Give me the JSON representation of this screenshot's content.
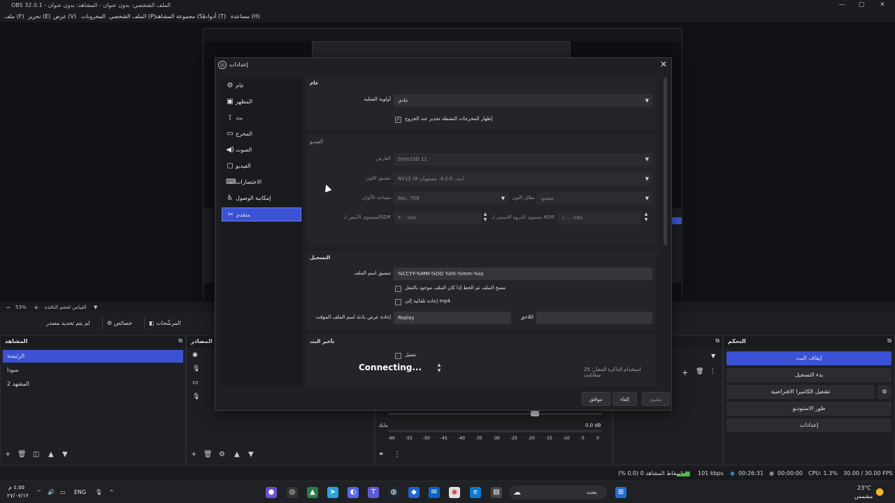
{
  "window": {
    "title": "OBS 32.0.1 - الملف الشخصي: بدون عنوان - المشاهد: بدون عنوان",
    "controls": [
      "—",
      "▢",
      "✕"
    ]
  },
  "menu": [
    "ملف (F)",
    "تحرير (E)",
    "عرض (V)",
    "المخزونات",
    "الملف الشخصي (P)",
    "مجموعة المشاهد (S)",
    "أدوات (T)",
    "مساعدة (H)"
  ],
  "preview_bar": {
    "zoom": "53%",
    "scale_label": "القياس لحجم النافذة"
  },
  "toolrow": {
    "no_source": "لم يتم تحديد مصدر",
    "properties": "خصائص",
    "filters": "المرشّحات"
  },
  "docks": {
    "scenes": {
      "title": "المشاهد",
      "items": [
        "الرئيسة",
        "سودا",
        "المشهد 2"
      ]
    },
    "sources": {
      "title": "المصادر"
    },
    "controls": {
      "title": "التحكم",
      "buttons": [
        "إيقاف البث",
        "بدء التسجيل",
        "تشغيل الكاميرا الافتراضية",
        "طور الاستوديو",
        "إعدادات"
      ]
    },
    "mixer": {
      "mic_label": "مايك",
      "db": "0.0 dB",
      "ticks": [
        "-60",
        "-55",
        "-50",
        "-45",
        "-40",
        "-35",
        "-30",
        "-25",
        "-20",
        "-15",
        "-10",
        "-5",
        "0"
      ]
    }
  },
  "status": {
    "dropped": "إسقاط المشاهد 0 (0.0 %)",
    "bitrate": "101 kbps",
    "stream_time": "00:26:31",
    "rec_time": "00:00:00",
    "cpu": "CPU: 1.3%",
    "fps": "30.00 / 30.00 FPS"
  },
  "taskbar": {
    "weather_temp": "23°C",
    "weather_desc": "مشمس",
    "search": "بحث",
    "lang": "ENG",
    "time": "٤:٥٥ م",
    "date": "٢٧/٠٧/١٢"
  },
  "dialog": {
    "title": "إعدادات",
    "nav": [
      {
        "label": "عام",
        "icon": "gear-icon",
        "glyph": "⚙"
      },
      {
        "label": "المظهر",
        "icon": "appearance-icon",
        "glyph": "▣"
      },
      {
        "label": "بث",
        "icon": "antenna-icon",
        "glyph": "📡"
      },
      {
        "label": "المخرج",
        "icon": "output-icon",
        "glyph": "▭"
      },
      {
        "label": "الصوت",
        "icon": "speaker-icon",
        "glyph": "🔊"
      },
      {
        "label": "الفيديو",
        "icon": "monitor-icon",
        "glyph": "▢"
      },
      {
        "label": "الاختصارات",
        "icon": "keyboard-icon",
        "glyph": "⌨"
      },
      {
        "label": "إمكانية الوصول",
        "icon": "accessibility-icon",
        "glyph": "♿"
      },
      {
        "label": "متقدم",
        "icon": "tools-icon",
        "glyph": "✂"
      }
    ],
    "general": {
      "header": "عام",
      "priority_label": "أولوية العملية",
      "priority_value": "عادي",
      "warn_label": "إظهار المخرجات النشطة تحذير عند الخروج"
    },
    "video": {
      "header": "الفيديو",
      "renderer_label": "العارض",
      "renderer_value": "Direct3D 11",
      "color_format_label": "تنسيق اللون",
      "color_format_value": "NV12 (8-بت، 4:2:0، مستويان)",
      "color_space_label": "مساحة الألوان",
      "color_space_value": "Rec. 709",
      "color_range_label": "نطاق اللون",
      "color_range_value": "محدود",
      "sdr_label": "المستوى الأبيض لـSDR",
      "sdr_value": "٣٠٠ nits",
      "hdr_label": "مستوى الذروة الاسمي لـ HDR",
      "hdr_value": "١٠٠٠ nits"
    },
    "recording": {
      "header": "التسجيل",
      "filename_label": "تنسيق اسم الملف",
      "filename_value": "%CCYY-%MM-%DD %hh-%mm-%ss",
      "overwrite_label": "مسح الملف ثم الخط إذا كان الملف موجود بالفعل",
      "remux_label": "إعادة تلقائية إلى mp4",
      "replay_prefix_label": "إعادة عرض بادئة اسم الملف المؤقت",
      "replay_prefix_value": "Replay",
      "suffix_label": "اللاحق",
      "suffix_value": ""
    },
    "stream_delay": {
      "header": "تأخير البث",
      "enable_label": "تفعيل",
      "connecting": "Connecting...",
      "memory_note": "استخدام الذاكرة المقدّر: 25 ميغابايت"
    },
    "buttons": {
      "ok": "موافق",
      "cancel": "إلغاء",
      "apply": "تطبيق"
    }
  }
}
